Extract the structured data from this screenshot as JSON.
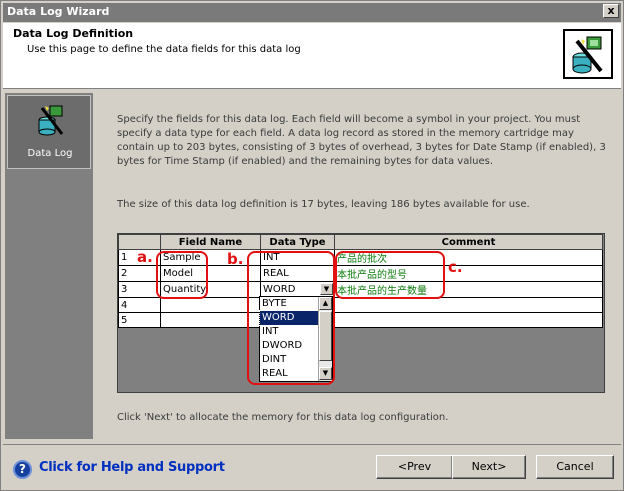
{
  "window": {
    "title": "Data Log Wizard",
    "close_label": "x"
  },
  "header": {
    "title": "Data Log Definition",
    "subtitle": "Use this page to define the data fields for this data log",
    "icon": "data-log-wizard-icon"
  },
  "sidebar": {
    "items": [
      {
        "label": "Data Log",
        "icon": "data-log-icon"
      }
    ]
  },
  "content": {
    "intro": "Specify the fields for this data log. Each field will become a symbol in your project. You must specify a data type for each field. A data log record as stored in the memory cartridge may contain up to 203 bytes, consisting of 3 bytes of overhead, 3 bytes for Date Stamp (if enabled), 3 bytes for Time Stamp (if enabled) and the remaining bytes for data values.",
    "size_info": "The size of this data log definition is 17 bytes, leaving 186 bytes available for use.",
    "next_hint": "Click 'Next' to allocate the memory for this data log configuration."
  },
  "grid": {
    "columns": [
      "Field Name",
      "Data Type",
      "Comment"
    ],
    "rows": [
      {
        "num": "1",
        "name": "Sample",
        "type": "INT",
        "comment": "产品的批次"
      },
      {
        "num": "2",
        "name": "Model",
        "type": "REAL",
        "comment": "本批产品的型号"
      },
      {
        "num": "3",
        "name": "Quantity",
        "type": "WORD",
        "comment": "本批产品的生产数量"
      },
      {
        "num": "4",
        "name": "",
        "type": "",
        "comment": ""
      },
      {
        "num": "5",
        "name": "",
        "type": "",
        "comment": ""
      }
    ],
    "dropdown_options": [
      "BYTE",
      "WORD",
      "INT",
      "DWORD",
      "DINT",
      "REAL"
    ],
    "dropdown_selected": "WORD"
  },
  "annotations": {
    "a": "a.",
    "b": "b.",
    "c": "c.",
    "color": "#e21010"
  },
  "footer": {
    "help_text": "Click for Help and Support",
    "prev_label": "<Prev",
    "next_label": "Next>",
    "cancel_label": "Cancel"
  }
}
